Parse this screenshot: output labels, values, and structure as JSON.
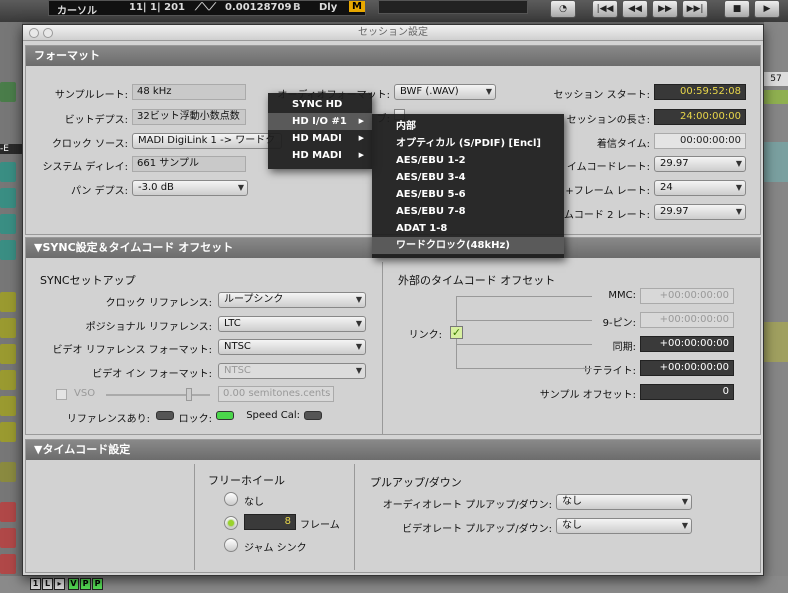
{
  "app_toolbar": {
    "cursor_label": "カーソル",
    "position": "11| 1| 201",
    "value": "0.00128709",
    "dly_label": "Dly",
    "m_label": "M",
    "b_label": "B"
  },
  "left_strip": {
    "e_label": "-E"
  },
  "right_strip": {
    "number": "57"
  },
  "bottom_bar": {
    "b1": "1",
    "b2": "L",
    "v1": "V",
    "v2": "P",
    "v3": "P"
  },
  "dialog": {
    "title": "セッション設定",
    "format": {
      "header": "フォーマット",
      "sample_rate_label": "サンプルレート:",
      "sample_rate": "48 kHz",
      "bit_depth_label": "ビットデプス:",
      "bit_depth": "32ビット浮動小数点数",
      "clock_source_label": "クロック ソース:",
      "clock_source": "MADI DigiLink 1 -> ワードク",
      "system_delay_label": "システム ディレイ:",
      "system_delay": "661 サンプル",
      "pan_depth_label": "パン デプス:",
      "pan_depth": "-3.0 dB",
      "audio_format_label": "オーディオフォーマット:",
      "audio_format": "BWF (.WAV)",
      "interleaved_label": "ブ:",
      "session_start_label": "セッション スタート:",
      "session_start": "00:59:52:08",
      "session_length_label": "セッションの長さ:",
      "session_length": "24:00:00:00",
      "incoming_time_label": "着信タイム:",
      "incoming_time": "00:00:00:00",
      "timecode_rate_label": "イムコードレート:",
      "timecode_rate": "29.97",
      "frame_rate_label": "+フレーム レート:",
      "frame_rate": "24",
      "timecode2_rate_label": "ムコード 2 レート:",
      "timecode2_rate": "29.97"
    },
    "sync": {
      "header": "SYNC設定＆タイムコード オフセット",
      "setup_title": "SYNCセットアップ",
      "clock_ref_label": "クロック リファレンス:",
      "clock_ref": "ループシンク",
      "pos_ref_label": "ポジショナル リファレンス:",
      "pos_ref": "LTC",
      "video_ref_label": "ビデオ リファレンス フォーマット:",
      "video_ref": "NTSC",
      "video_in_label": "ビデオ イン フォーマット:",
      "video_in": "NTSC",
      "vso_label": "VSO",
      "vso_value": "0.00  semitones.cents",
      "ref_present_label": "リファレンスあり:",
      "lock_label": "ロック:",
      "speed_cal_label": "Speed Cal:",
      "offset_title": "外部のタイムコード オフセット",
      "mmc_label": "MMC:",
      "mmc": "+00:00:00:00",
      "pin9_label": "9-ピン:",
      "pin9": "+00:00:00:00",
      "link_label": "リンク:",
      "sync_label": "同期:",
      "sync": "+00:00:00:00",
      "satellite_label": "サテライト:",
      "satellite": "+00:00:00:00",
      "sample_offset_label": "サンプル オフセット:",
      "sample_offset": "0"
    },
    "timecode": {
      "header": "タイムコード設定",
      "freewheel_title": "フリーホイール",
      "none_label": "なし",
      "frames_value": "8",
      "frames_label": "フレーム",
      "jam_label": "ジャム シンク",
      "pullup_title": "プルアップ/ダウン",
      "audio_pull_label": "オーディオレート プルアップ/ダウン:",
      "audio_pull": "なし",
      "video_pull_label": "ビデオレート プルアップ/ダウン:",
      "video_pull": "なし"
    }
  },
  "menu_main": {
    "items": [
      "SYNC HD",
      "HD I/O #1",
      "HD MADI",
      "HD MADI"
    ]
  },
  "menu_sub": {
    "items": [
      "内部",
      "オプティカル (S/PDIF) [Encl]",
      "AES/EBU 1-2",
      "AES/EBU 3-4",
      "AES/EBU 5-6",
      "AES/EBU 7-8",
      "ADAT 1-8",
      "ワードクロック(48kHz)"
    ]
  }
}
